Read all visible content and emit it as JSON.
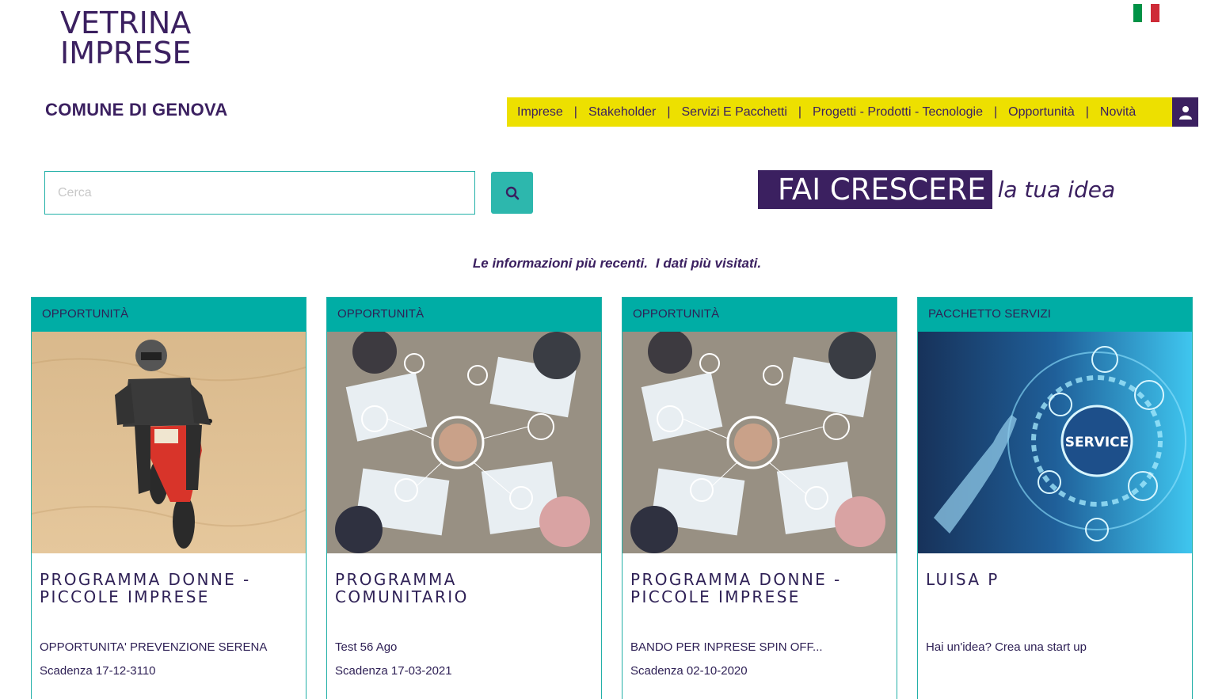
{
  "logo": {
    "line1": "VETRINA",
    "line2": "IMPRESE"
  },
  "language_flag": {
    "icon": "italian-flag-icon",
    "colors": [
      "#009246",
      "#ffffff",
      "#ce2b37"
    ]
  },
  "municipality": "COMUNE DI GENOVA",
  "nav": {
    "items": [
      "Imprese",
      "Stakeholder",
      "Servizi E Pacchetti",
      "Progetti - Prodotti - Tecnologie",
      "Opportunità",
      "Novità"
    ],
    "separator": "|",
    "user_icon": "user-icon"
  },
  "search": {
    "placeholder": "Cerca",
    "value": "",
    "button_icon": "search-icon"
  },
  "slogan": {
    "highlight": "FAI CRESCERE",
    "rest": "la tua idea"
  },
  "tagline": {
    "part1": "Le informazioni più recenti.",
    "part2": "I dati più visitati."
  },
  "cards": [
    {
      "tag": "OPPORTUNITÀ",
      "image": "motorcycle-desert-image",
      "title": "PROGRAMMA DONNE - PICCOLE IMPRESE",
      "description": "OPPORTUNITA' PREVENZIONE SERENA",
      "deadline": "Scadenza 17-12-3110"
    },
    {
      "tag": "OPPORTUNITÀ",
      "image": "teamwork-hands-image",
      "title": "PROGRAMMA COMUNITARIO",
      "description": "Test 56 Ago",
      "deadline": "Scadenza 17-03-2021"
    },
    {
      "tag": "OPPORTUNITÀ",
      "image": "teamwork-hands-image",
      "title": "PROGRAMMA DONNE - PICCOLE IMPRESE",
      "description": "BANDO PER INPRESE SPIN OFF...",
      "deadline": "Scadenza 02-10-2020"
    },
    {
      "tag": "PACCHETTO SERVIZI",
      "image": "service-hologram-image",
      "title": "LUISA P",
      "description": "Hai un'idea? Crea una start up",
      "deadline": ""
    }
  ],
  "service_image_text": "SERVICE",
  "colors": {
    "brand_purple": "#3b2060",
    "nav_yellow": "#ede000",
    "teal": "#00ada5",
    "search_teal": "#2db7ad"
  }
}
